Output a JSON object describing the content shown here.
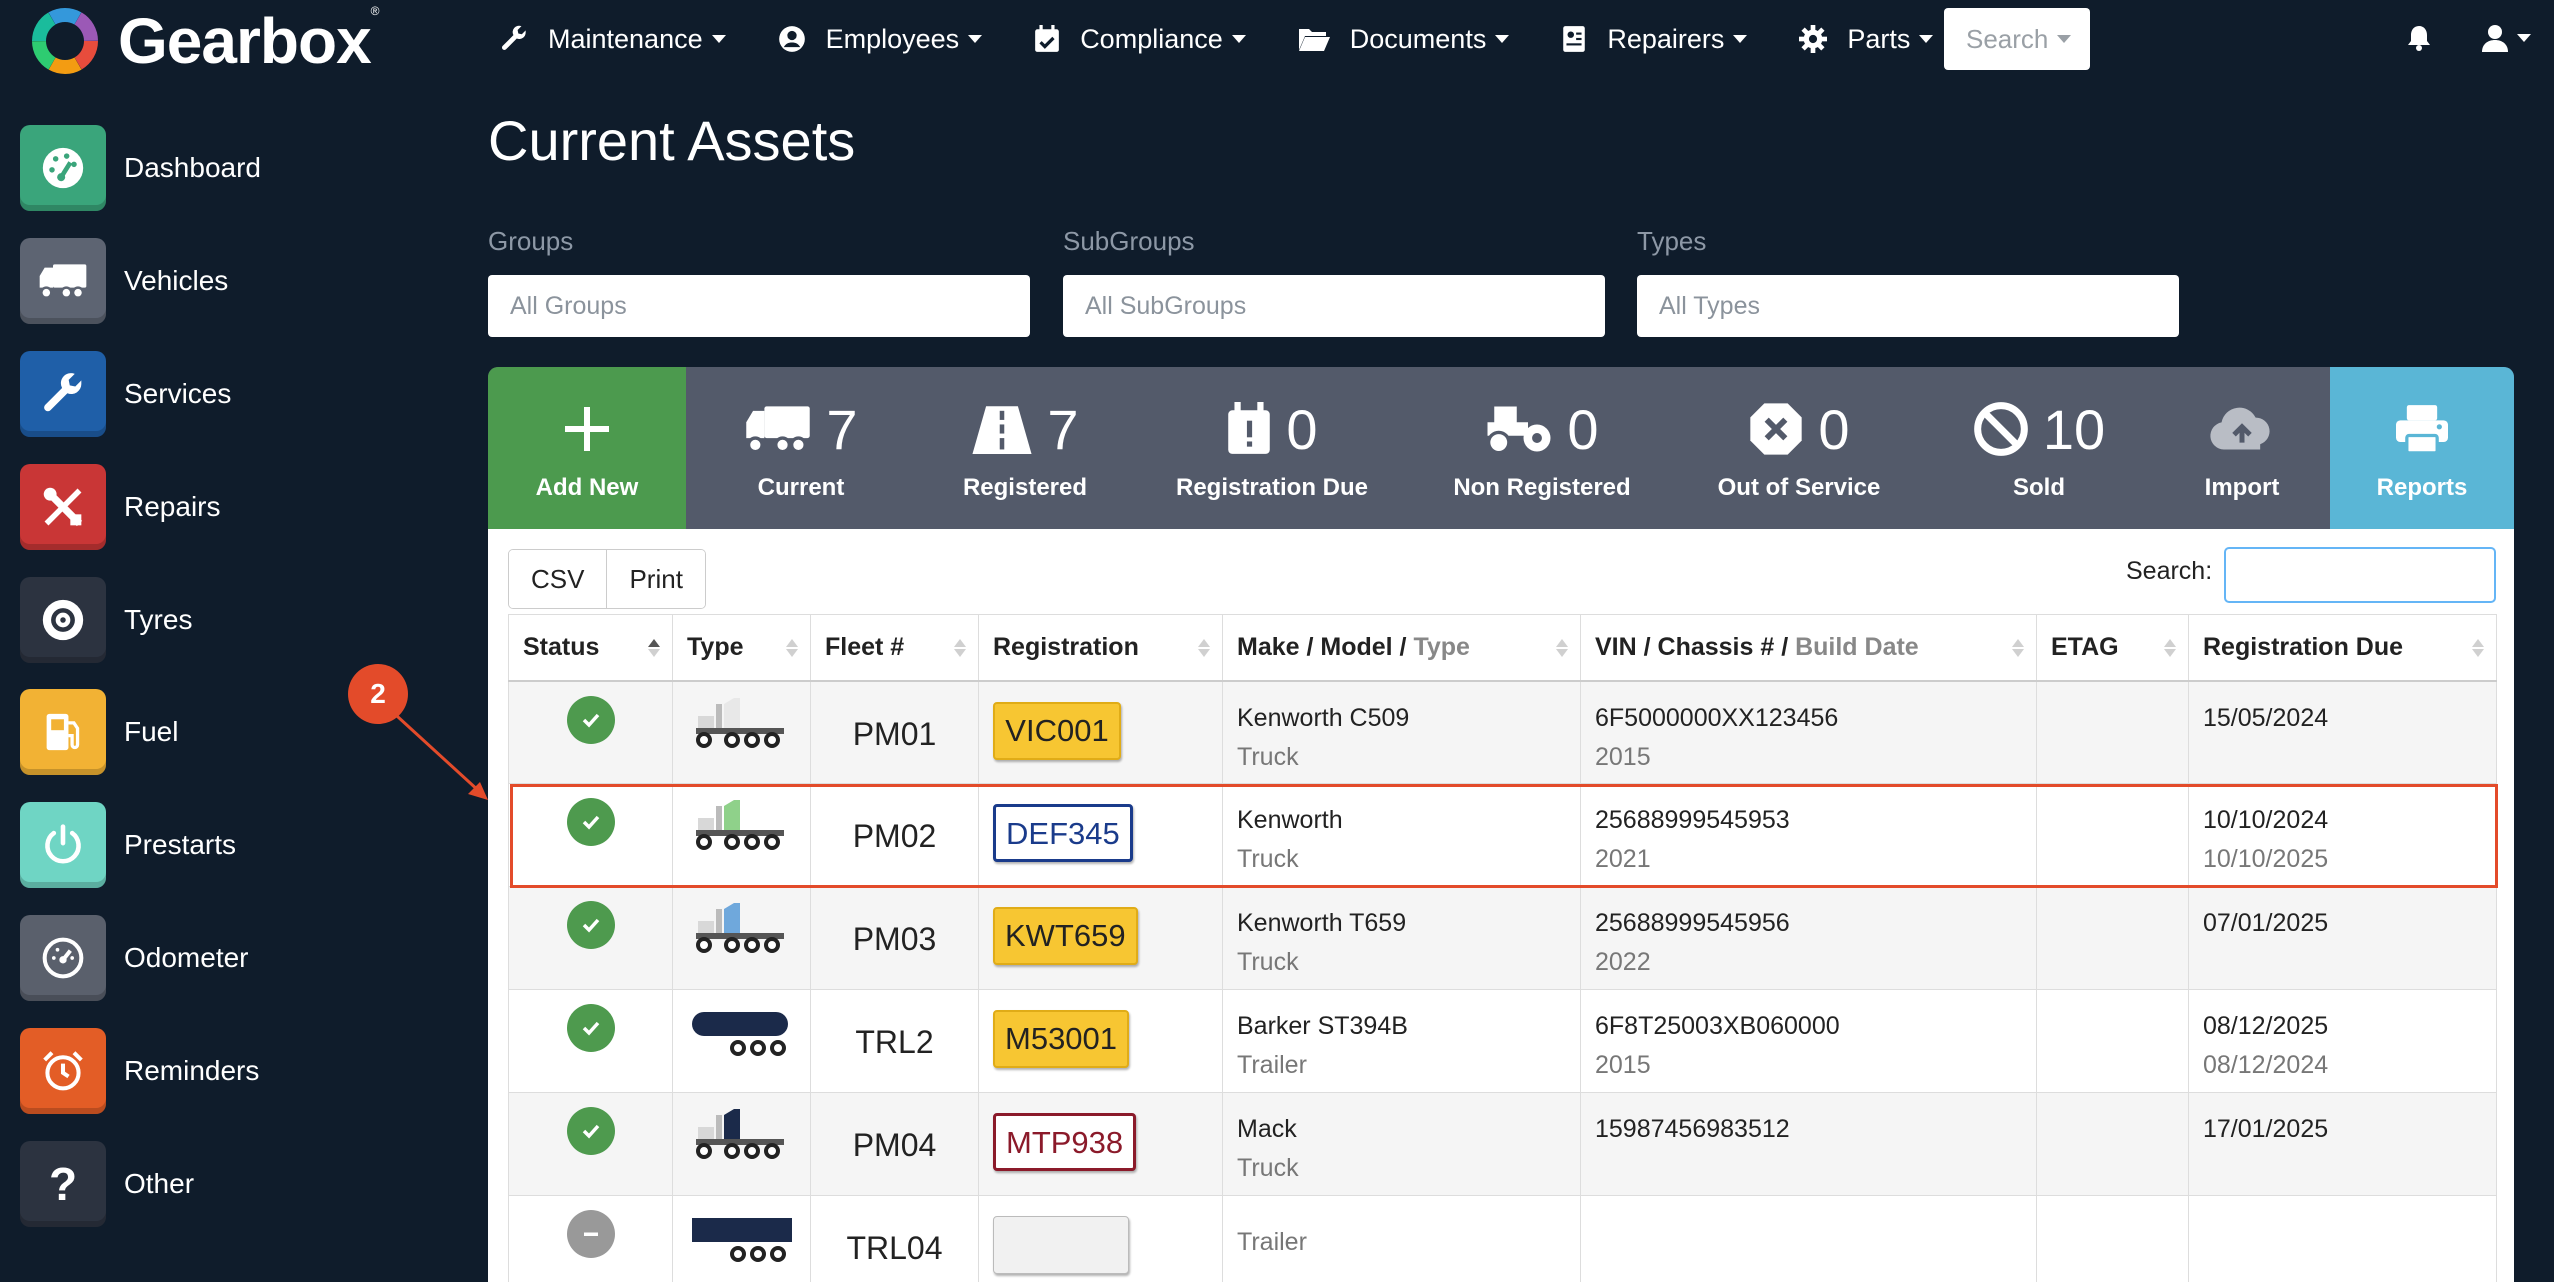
{
  "brand": {
    "name": "Gearbox",
    "mark": "®"
  },
  "topnav": [
    {
      "label": "Maintenance",
      "icon": "wrench-icon"
    },
    {
      "label": "Employees",
      "icon": "user-circle-icon"
    },
    {
      "label": "Compliance",
      "icon": "calendar-check-icon"
    },
    {
      "label": "Documents",
      "icon": "folder-open-icon"
    },
    {
      "label": "Repairers",
      "icon": "address-card-icon"
    },
    {
      "label": "Parts",
      "icon": "gear-icon"
    }
  ],
  "top_search": {
    "label": "Search"
  },
  "sidebar": [
    {
      "label": "Dashboard",
      "color": "#3aa57b"
    },
    {
      "label": "Vehicles",
      "color": "#5d6472"
    },
    {
      "label": "Services",
      "color": "#1f5fa8"
    },
    {
      "label": "Repairs",
      "color": "#c93636"
    },
    {
      "label": "Tyres",
      "color": "#2c3340"
    },
    {
      "label": "Fuel",
      "color": "#f2b234"
    },
    {
      "label": "Prestarts",
      "color": "#6fd5c4"
    },
    {
      "label": "Odometer",
      "color": "#5a606c"
    },
    {
      "label": "Reminders",
      "color": "#e35d26"
    },
    {
      "label": "Other",
      "color": "#2c3340"
    }
  ],
  "page": {
    "title": "Current Assets"
  },
  "filters": {
    "groups": {
      "label": "Groups",
      "value": "All Groups"
    },
    "subgroups": {
      "label": "SubGroups",
      "value": "All SubGroups"
    },
    "types": {
      "label": "Types",
      "value": "All Types"
    }
  },
  "stats": {
    "add_new": {
      "label": "Add New"
    },
    "current": {
      "count": "7",
      "label": "Current"
    },
    "registered": {
      "count": "7",
      "label": "Registered"
    },
    "registration_due": {
      "count": "0",
      "label": "Registration Due"
    },
    "non_registered": {
      "count": "0",
      "label": "Non Registered"
    },
    "out_of_service": {
      "count": "0",
      "label": "Out of Service"
    },
    "sold": {
      "count": "10",
      "label": "Sold"
    },
    "import": {
      "label": "Import"
    },
    "reports": {
      "label": "Reports"
    }
  },
  "table_tools": {
    "csv": "CSV",
    "print": "Print",
    "search_label": "Search:"
  },
  "table": {
    "columns": {
      "status": "Status",
      "type": "Type",
      "fleet": "Fleet #",
      "registration": "Registration",
      "make": "Make / Model /",
      "make_sub": "Type",
      "vin": "VIN / Chassis # /",
      "vin_sub": "Build Date",
      "etag": "ETAG",
      "reg_due": "Registration Due"
    },
    "rows": [
      {
        "fleet": "PM01",
        "rego": "VIC001",
        "plate": "yellow",
        "make": "Kenworth C509",
        "type": "Truck",
        "vin": "6F5000000XX123456",
        "build": "2015",
        "etag": "",
        "due": "15/05/2024",
        "due2": "",
        "status": "active",
        "vehicle_icon": "truck-icon",
        "vehicle_color": "#e8e8e8"
      },
      {
        "fleet": "PM02",
        "rego": "DEF345",
        "plate": "white-blue",
        "make": "Kenworth",
        "type": "Truck",
        "vin": "25688999545953",
        "build": "2021",
        "etag": "",
        "due": "10/10/2024",
        "due2": "10/10/2025",
        "status": "active",
        "vehicle_icon": "truck-icon",
        "vehicle_color": "#8fd18a"
      },
      {
        "fleet": "PM03",
        "rego": "KWT659",
        "plate": "yellow",
        "make": "Kenworth T659",
        "type": "Truck",
        "vin": "25688999545956",
        "build": "2022",
        "etag": "",
        "due": "07/01/2025",
        "due2": "",
        "status": "active",
        "vehicle_icon": "truck-icon",
        "vehicle_color": "#6fa8dc"
      },
      {
        "fleet": "TRL2",
        "rego": "M53001",
        "plate": "yellow",
        "make": "Barker ST394B",
        "type": "Trailer",
        "vin": "6F8T25003XB060000",
        "build": "2015",
        "etag": "",
        "due": "08/12/2025",
        "due2": "08/12/2024",
        "status": "active",
        "vehicle_icon": "tanker-trailer-icon",
        "vehicle_color": "#1b2a4a"
      },
      {
        "fleet": "PM04",
        "rego": "MTP938",
        "plate": "white-red",
        "make": "Mack",
        "type": "Truck",
        "vin": "15987456983512",
        "build": "",
        "etag": "",
        "due": "17/01/2025",
        "due2": "",
        "status": "active",
        "vehicle_icon": "truck-icon",
        "vehicle_color": "#1b2a4a"
      },
      {
        "fleet": "TRL04",
        "rego": "",
        "plate": "blank",
        "make": "",
        "type": "Trailer",
        "vin": "",
        "build": "",
        "etag": "",
        "due": "",
        "due2": "",
        "status": "inactive",
        "vehicle_icon": "box-trailer-icon",
        "vehicle_color": "#1b2a4a"
      }
    ]
  },
  "annotation": {
    "number": "2",
    "color": "#e34b2a"
  }
}
